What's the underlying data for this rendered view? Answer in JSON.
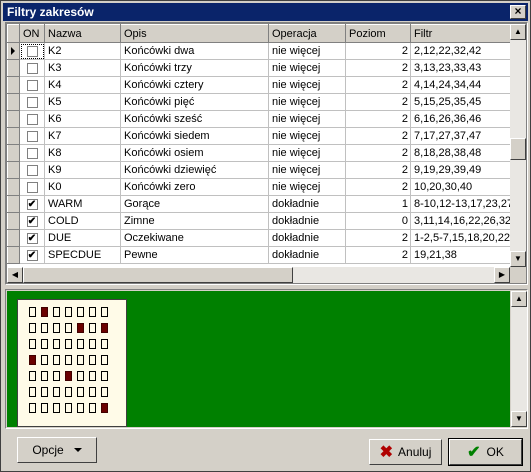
{
  "window": {
    "title": "Filtry zakresów",
    "close_glyph": "×"
  },
  "grid": {
    "columns": [
      "ON",
      "Nazwa",
      "Opis",
      "Operacja",
      "Poziom",
      "Filtr"
    ],
    "rows": [
      {
        "on": false,
        "nazwa": "K2",
        "opis": "Końcówki dwa",
        "operacja": "nie więcej",
        "poziom": "2",
        "filtr": "2,12,22,32,42",
        "current": true
      },
      {
        "on": false,
        "nazwa": "K3",
        "opis": "Końcówki trzy",
        "operacja": "nie więcej",
        "poziom": "2",
        "filtr": "3,13,23,33,43"
      },
      {
        "on": false,
        "nazwa": "K4",
        "opis": "Końcówki cztery",
        "operacja": "nie więcej",
        "poziom": "2",
        "filtr": "4,14,24,34,44"
      },
      {
        "on": false,
        "nazwa": "K5",
        "opis": "Końcówki pięć",
        "operacja": "nie więcej",
        "poziom": "2",
        "filtr": "5,15,25,35,45"
      },
      {
        "on": false,
        "nazwa": "K6",
        "opis": "Końcówki sześć",
        "operacja": "nie więcej",
        "poziom": "2",
        "filtr": "6,16,26,36,46"
      },
      {
        "on": false,
        "nazwa": "K7",
        "opis": "Końcówki siedem",
        "operacja": "nie więcej",
        "poziom": "2",
        "filtr": "7,17,27,37,47"
      },
      {
        "on": false,
        "nazwa": "K8",
        "opis": "Końcówki osiem",
        "operacja": "nie więcej",
        "poziom": "2",
        "filtr": "8,18,28,38,48"
      },
      {
        "on": false,
        "nazwa": "K9",
        "opis": "Końcówki dziewięć",
        "operacja": "nie więcej",
        "poziom": "2",
        "filtr": "9,19,29,39,49"
      },
      {
        "on": false,
        "nazwa": "K0",
        "opis": "Końcówki zero",
        "operacja": "nie więcej",
        "poziom": "2",
        "filtr": "10,20,30,40"
      },
      {
        "on": true,
        "nazwa": "WARM",
        "opis": "Gorące",
        "operacja": "dokładnie",
        "poziom": "1",
        "filtr": "8-10,12-13,17,23,27-"
      },
      {
        "on": true,
        "nazwa": "COLD",
        "opis": "Zimne",
        "operacja": "dokładnie",
        "poziom": "0",
        "filtr": "3,11,14,16,22,26,32"
      },
      {
        "on": true,
        "nazwa": "DUE",
        "opis": "Oczekiwane",
        "operacja": "dokładnie",
        "poziom": "2",
        "filtr": "1-2,5-7,15,18,20,22,2"
      },
      {
        "on": true,
        "nazwa": "SPECDUE",
        "opis": "Pewne",
        "operacja": "dokładnie",
        "poziom": "2",
        "filtr": "19,21,38"
      }
    ]
  },
  "icons": {
    "check": "✔",
    "scroll_up": "▲",
    "scroll_down": "▼",
    "scroll_left": "◀",
    "scroll_right": "▶"
  },
  "ticket": {
    "grid_cols": 7,
    "grid_rows": 7,
    "marked": [
      [
        0,
        1
      ],
      [
        1,
        4
      ],
      [
        1,
        6
      ],
      [
        3,
        0
      ],
      [
        4,
        3
      ],
      [
        6,
        6
      ]
    ]
  },
  "buttons": {
    "options": "Opcje",
    "cancel": "Anuluj",
    "ok": "OK"
  },
  "colors": {
    "preview_bg": "#008000",
    "mark": "#6b0000",
    "titlebar": "#0a246a"
  }
}
